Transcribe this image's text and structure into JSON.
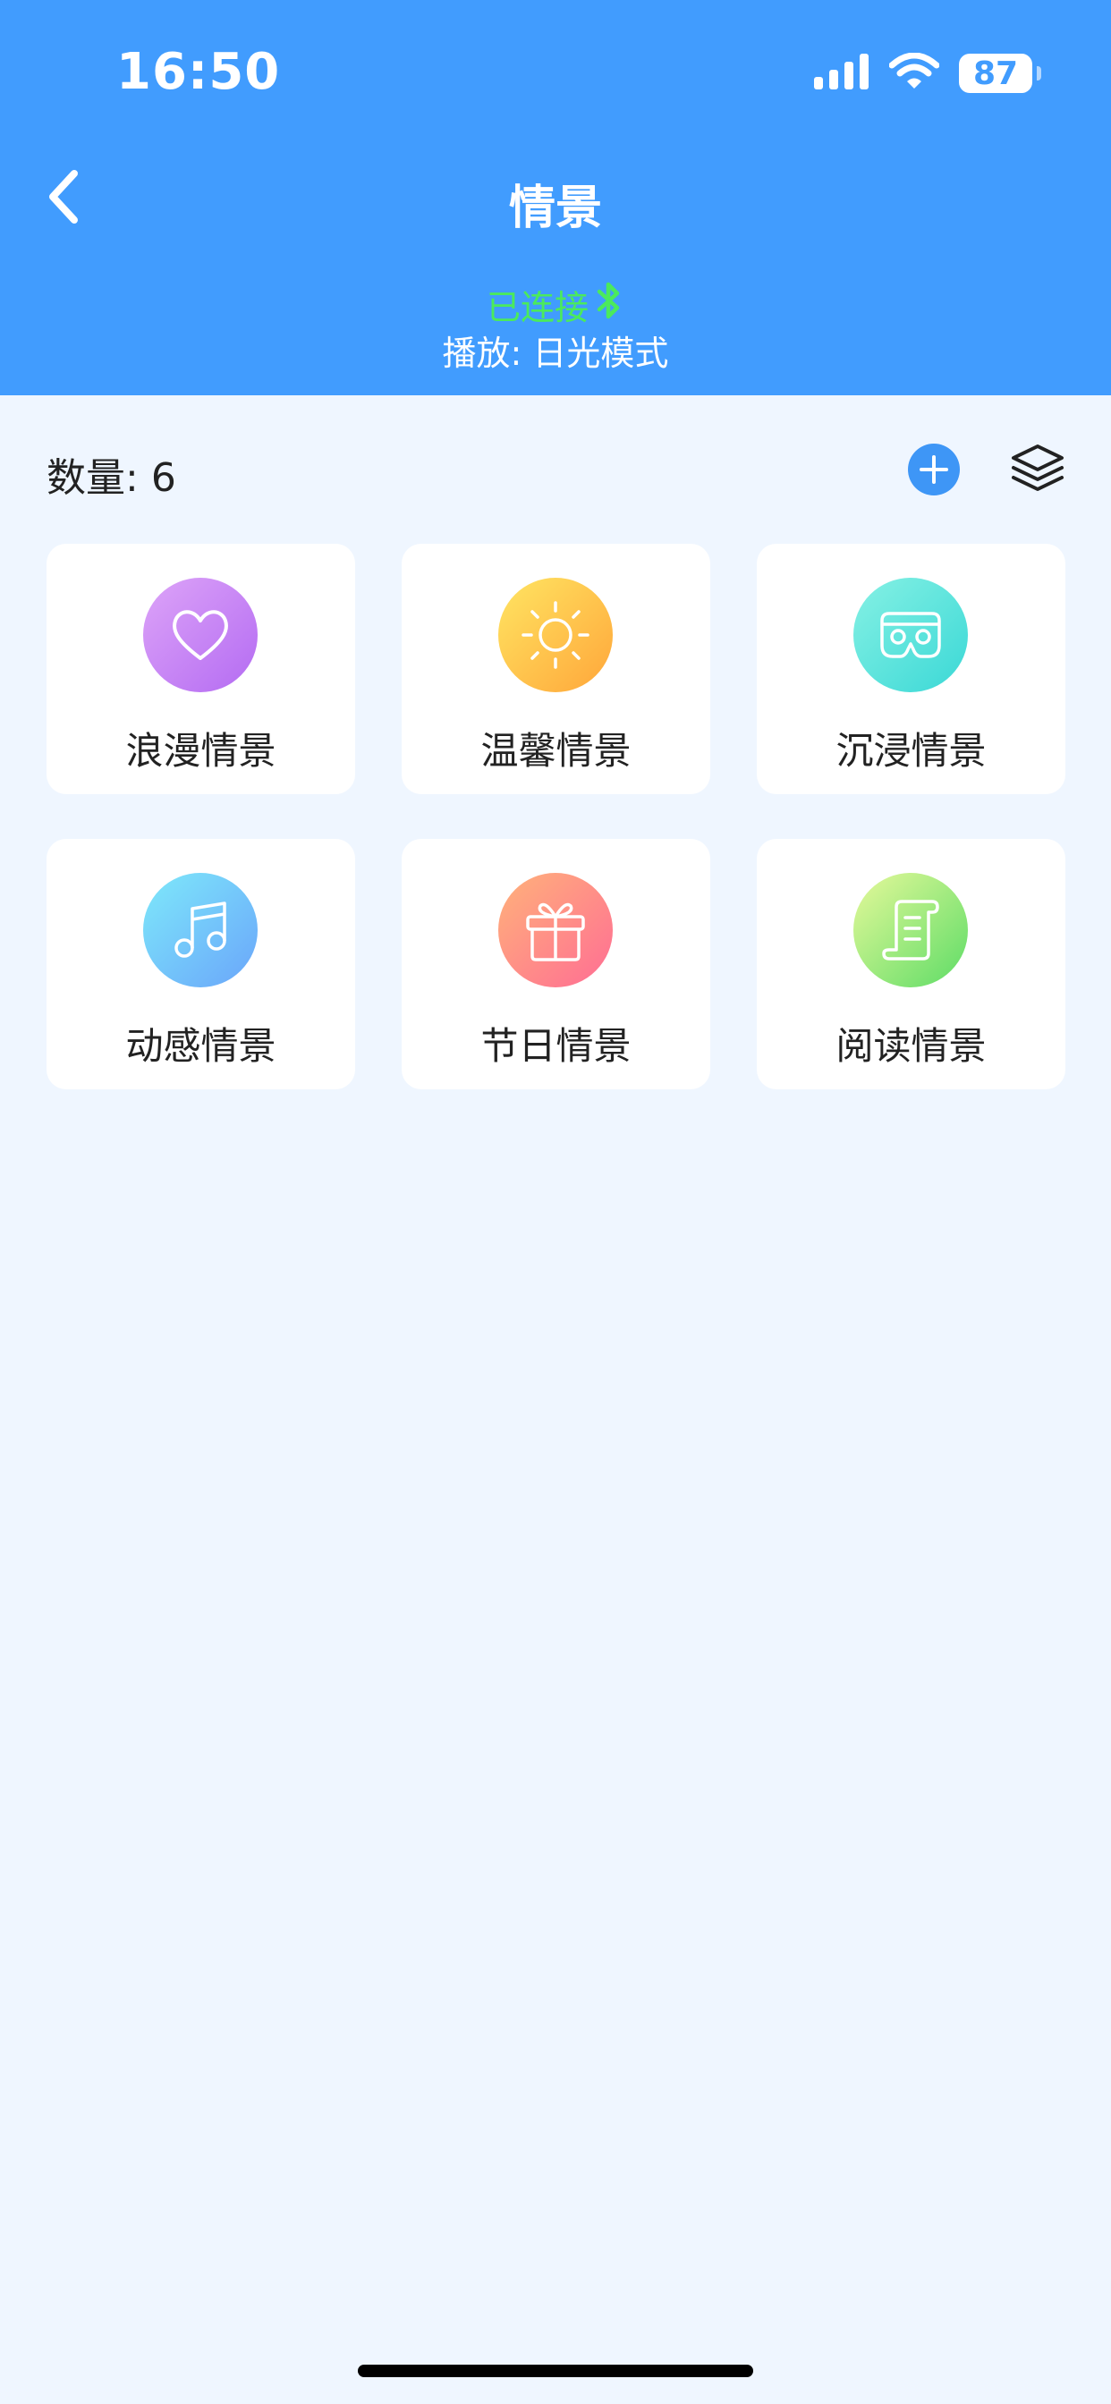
{
  "status_bar": {
    "time": "16:50",
    "battery": "87"
  },
  "nav": {
    "title": "情景"
  },
  "connection": {
    "status": "已连接",
    "playing": "播放: 日光模式",
    "status_color": "#4BEA5C"
  },
  "toolbar": {
    "count_label": "数量:",
    "count_value": "6"
  },
  "scenes": [
    {
      "label": "浪漫情景",
      "icon": "heart-icon",
      "gradient": [
        "#DDA4F8",
        "#B46BF2"
      ]
    },
    {
      "label": "温馨情景",
      "icon": "sun-icon",
      "gradient": [
        "#FFE562",
        "#FFA63A"
      ]
    },
    {
      "label": "沉浸情景",
      "icon": "vr-goggles-icon",
      "gradient": [
        "#86F1E4",
        "#3AD8D6"
      ]
    },
    {
      "label": "动感情景",
      "icon": "music-note-icon",
      "gradient": [
        "#7EE9FA",
        "#6AA5FA"
      ]
    },
    {
      "label": "节日情景",
      "icon": "gift-icon",
      "gradient": [
        "#FFB27A",
        "#FF6D94"
      ]
    },
    {
      "label": "阅读情景",
      "icon": "scroll-icon",
      "gradient": [
        "#E6F99A",
        "#5DDC66"
      ]
    }
  ],
  "colors": {
    "header": "#419CFE",
    "background": "#EFF6FF",
    "accent": "#3E96F6"
  }
}
